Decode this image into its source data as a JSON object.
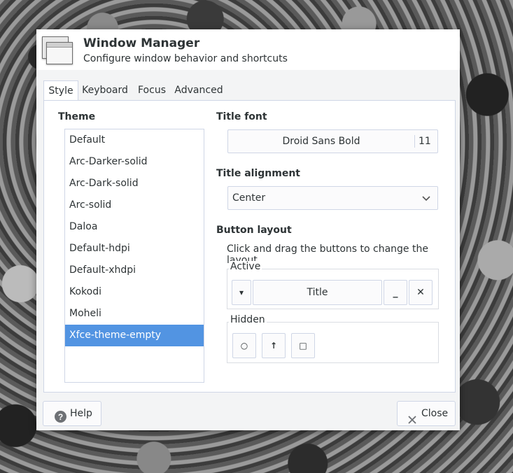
{
  "window": {
    "title": "Window Manager",
    "subtitle": "Configure window behavior and shortcuts",
    "icon": "window-manager-icon"
  },
  "tabs": [
    {
      "label": "Style",
      "active": true
    },
    {
      "label": "Keyboard",
      "active": false
    },
    {
      "label": "Focus",
      "active": false
    },
    {
      "label": "Advanced",
      "active": false
    }
  ],
  "theme": {
    "heading": "Theme",
    "items": [
      "Default",
      "Arc-Darker-solid",
      "Arc-Dark-solid",
      "Arc-solid",
      "Daloa",
      "Default-hdpi",
      "Default-xhdpi",
      "Kokodi",
      "Moheli",
      "Xfce-theme-empty"
    ],
    "selected": "Xfce-theme-empty"
  },
  "title_font": {
    "heading": "Title font",
    "name": "Droid Sans Bold",
    "size": "11"
  },
  "title_alignment": {
    "heading": "Title alignment",
    "value": "Center"
  },
  "button_layout": {
    "heading": "Button layout",
    "hint": "Click and drag the buttons to change the layout",
    "active_label": "Active",
    "hidden_label": "Hidden",
    "active_buttons": {
      "menu": "▾",
      "title": "Title",
      "minimize": "_",
      "close": "✕"
    },
    "hidden_buttons": {
      "stick": "○",
      "shade": "↑",
      "maximize": "□"
    }
  },
  "footer": {
    "help_label": "Help",
    "close_label": "Close"
  },
  "colors": {
    "selection": "#5294e2",
    "window_bg": "#f3f4f5",
    "border": "#cfd6e6"
  }
}
